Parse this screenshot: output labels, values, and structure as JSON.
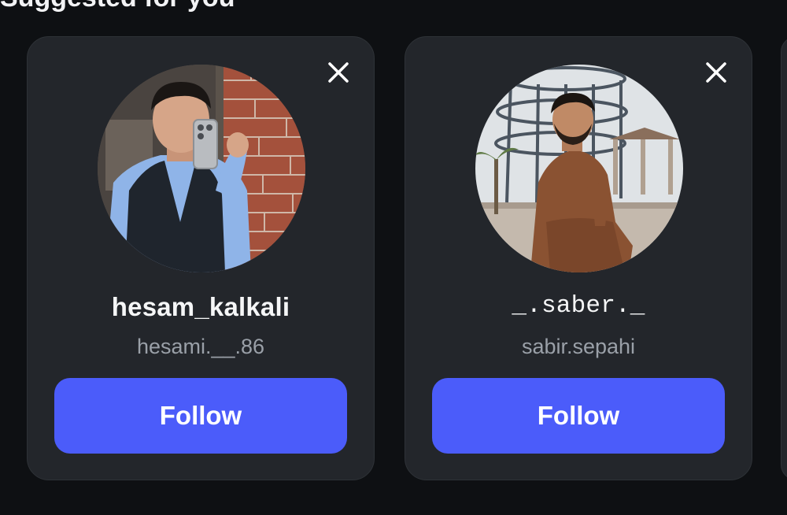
{
  "section": {
    "title": "Suggested for you"
  },
  "cards": [
    {
      "username": "hesam_kalkali",
      "full_name": "hesami.__.86",
      "follow_label": "Follow",
      "dismiss_icon": "close-icon"
    },
    {
      "username": "_.saber._",
      "full_name": "sabir.sepahi",
      "follow_label": "Follow",
      "dismiss_icon": "close-icon"
    }
  ],
  "colors": {
    "background": "#0e1013",
    "card": "#23262b",
    "accent": "#4b5cfa",
    "primary_text": "#f5f6f7",
    "secondary_text": "#9aa0a8"
  }
}
